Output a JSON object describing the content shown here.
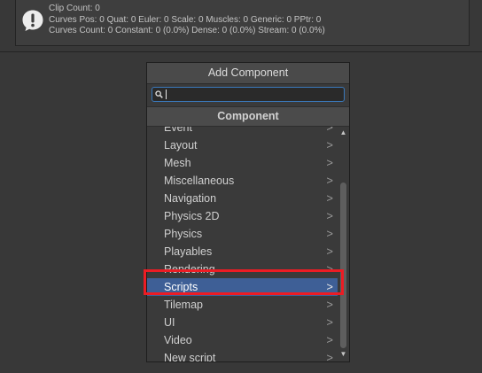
{
  "info_box": {
    "icon": "exclamation-icon",
    "lines": [
      "Clip Count: 0",
      "Curves Pos: 0 Quat: 0 Euler: 0 Scale: 0 Muscles: 0 Generic: 0 PPtr: 0",
      "Curves Count: 0 Constant: 0 (0.0%) Dense: 0 (0.0%) Stream: 0 (0.0%)"
    ]
  },
  "popup": {
    "title": "Add Component",
    "search": {
      "value": "",
      "placeholder": ""
    },
    "section": "Component",
    "partial_item": "Event",
    "items": [
      "Layout",
      "Mesh",
      "Miscellaneous",
      "Navigation",
      "Physics 2D",
      "Physics",
      "Playables",
      "Rendering",
      "Scripts",
      "Tilemap",
      "UI",
      "Video",
      "New script"
    ],
    "selected_item": "Scripts",
    "chevron": ">",
    "scroll_up": "▲",
    "scroll_down": "▼"
  },
  "colors": {
    "background": "#383838",
    "selection": "#3e5f96",
    "highlight": "#ec1c24",
    "search_border": "#3a79bb"
  }
}
